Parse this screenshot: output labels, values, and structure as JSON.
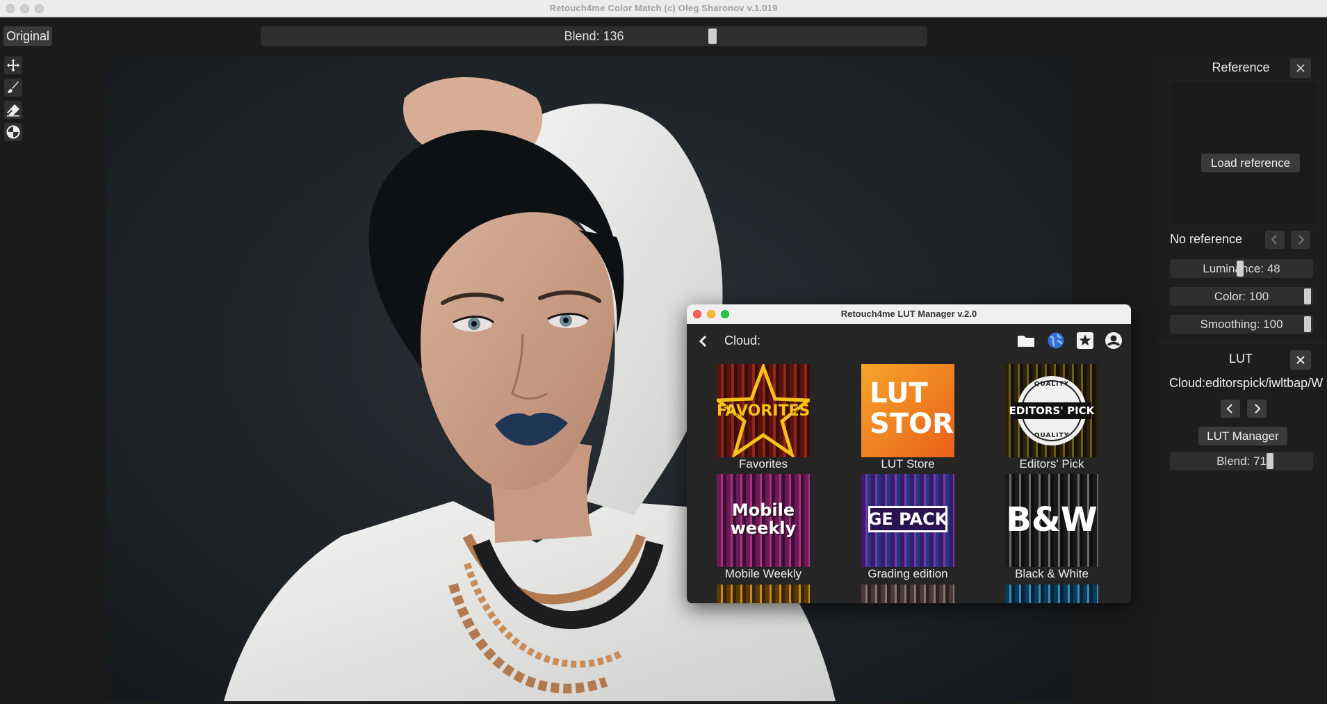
{
  "window": {
    "title": "Retouch4me Color Match (c) Oleg Sharonov v.1.019"
  },
  "toolbar": {
    "original_label": "Original",
    "blend_label": "Blend: 136",
    "blend_value": 136,
    "blend_fraction": 0.68
  },
  "tools": [
    {
      "icon": "move-icon"
    },
    {
      "icon": "brush-icon"
    },
    {
      "icon": "eraser-icon"
    },
    {
      "icon": "color-picker-icon"
    }
  ],
  "reference": {
    "header": "Reference",
    "load_label": "Load reference",
    "status": "No reference",
    "luminance_label": "Luminance: 48",
    "luminance_fraction": 0.48,
    "color_label": "Color: 100",
    "color_fraction": 1.0,
    "smoothing_label": "Smoothing: 100",
    "smoothing_fraction": 1.0
  },
  "lut": {
    "header": "LUT",
    "path": "Cloud:editorspick/iwltbap/W",
    "manager_label": "LUT Manager",
    "blend_label": "Blend: 71",
    "blend_fraction": 0.71
  },
  "lut_manager": {
    "title": "Retouch4me LUT Manager v.2.0",
    "location_label": "Cloud:",
    "items": [
      {
        "label": "Favorites",
        "thumb_text": "FAVORITES"
      },
      {
        "label": "LUT Store",
        "thumb_text_1": "LUT",
        "thumb_text_2": "STORE"
      },
      {
        "label": "Editors' Pick",
        "thumb_text": "EDITORS' PICK",
        "seal_text_top": "QUALITY",
        "seal_text_bottom": "QUALITY"
      },
      {
        "label": "Mobile Weekly",
        "thumb_text_1": "Mobile",
        "thumb_text_2": "weekly"
      },
      {
        "label": "Grading edition",
        "thumb_text": "GE PACK"
      },
      {
        "label": "Black & White",
        "thumb_text": "B&W"
      }
    ]
  },
  "colors": {
    "accent_blue": "#2f6fd6",
    "background": "#1b1b1b",
    "panel": "#1d1d1d"
  }
}
